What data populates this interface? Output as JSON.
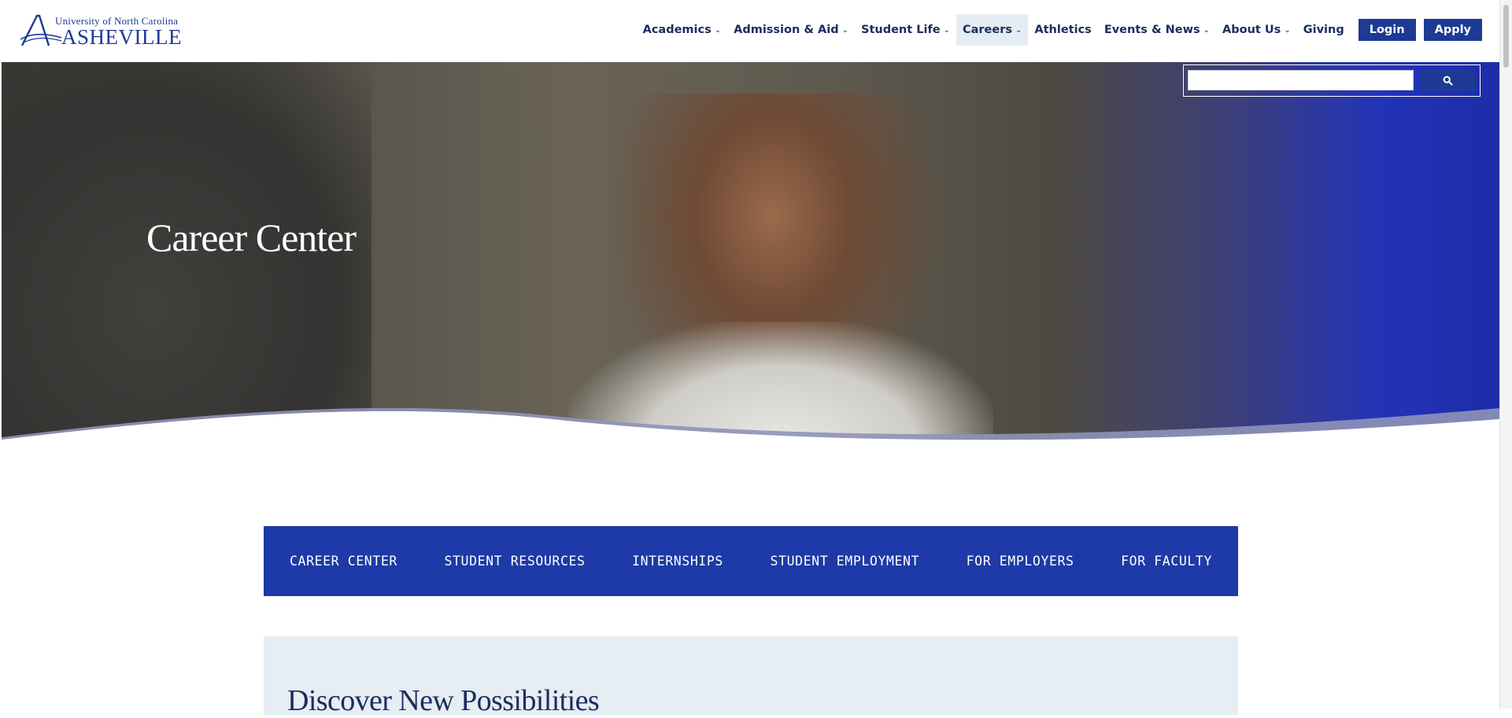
{
  "brand": {
    "line1": "University of North Carolina",
    "line2": "ASHEVILLE",
    "color": "#1d3a94"
  },
  "nav": {
    "items": [
      {
        "label": "Academics",
        "dropdown": true
      },
      {
        "label": "Admission & Aid",
        "dropdown": true
      },
      {
        "label": "Student Life",
        "dropdown": true
      },
      {
        "label": "Careers",
        "dropdown": true,
        "active": true
      },
      {
        "label": "Athletics",
        "dropdown": false
      },
      {
        "label": "Events & News",
        "dropdown": true
      },
      {
        "label": "About Us",
        "dropdown": true
      },
      {
        "label": "Giving",
        "dropdown": false
      }
    ],
    "login_label": "Login",
    "apply_label": "Apply"
  },
  "search": {
    "value": "",
    "icon": "search-icon"
  },
  "hero": {
    "title": "Career Center"
  },
  "subnav": {
    "items": [
      "CAREER CENTER",
      "STUDENT RESOURCES",
      "INTERNSHIPS",
      "STUDENT EMPLOYMENT",
      "FOR EMPLOYERS",
      "FOR FACULTY"
    ],
    "background": "#1d3aa8"
  },
  "panel": {
    "title": "Discover New Possibilities"
  }
}
